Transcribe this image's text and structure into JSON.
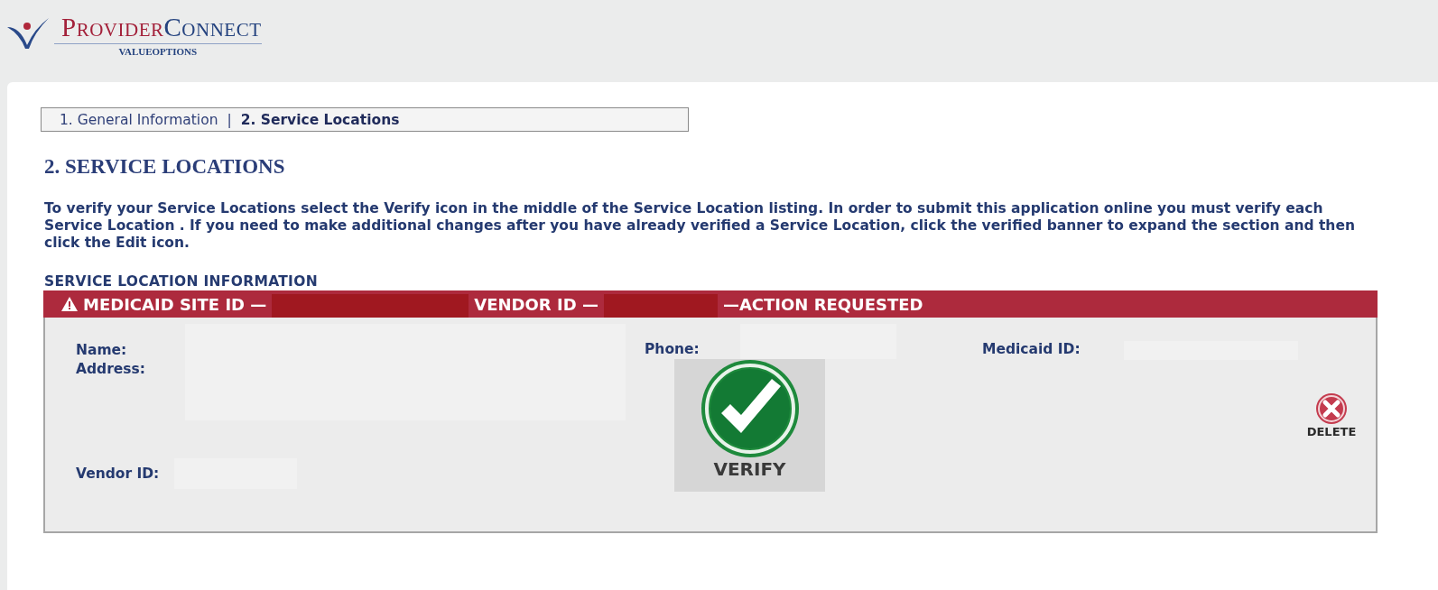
{
  "logo": {
    "part1": "PROVIDER",
    "part2": "CONNECT",
    "sub": "VALUEOPTIONS"
  },
  "steps": [
    {
      "label": "1. General Information",
      "selected": false
    },
    {
      "label": "2. Service Locations",
      "selected": true
    }
  ],
  "step_separator": "|",
  "heading": "2. SERVICE LOCATIONS",
  "instructions": "To verify your Service Locations select the Verify icon in the middle of the Service Location listing. In order to submit this application online you must verify each Service Location . If you need to make additional changes after you have already verified a Service Location, click the verified banner to expand the section and then click the Edit icon.",
  "section_label": "SERVICE LOCATION INFORMATION",
  "location": {
    "site_id_label": "MEDICAID SITE ID —",
    "vendor_id_label": "VENDOR ID —",
    "status": "—ACTION REQUESTED",
    "name_label": "Name:",
    "address_label": "Address:",
    "phone_label": "Phone:",
    "medicaid_id_label": "Medicaid ID:",
    "vendor_label": "Vendor ID:",
    "verify": "VERIFY",
    "delete": "DELETE"
  }
}
